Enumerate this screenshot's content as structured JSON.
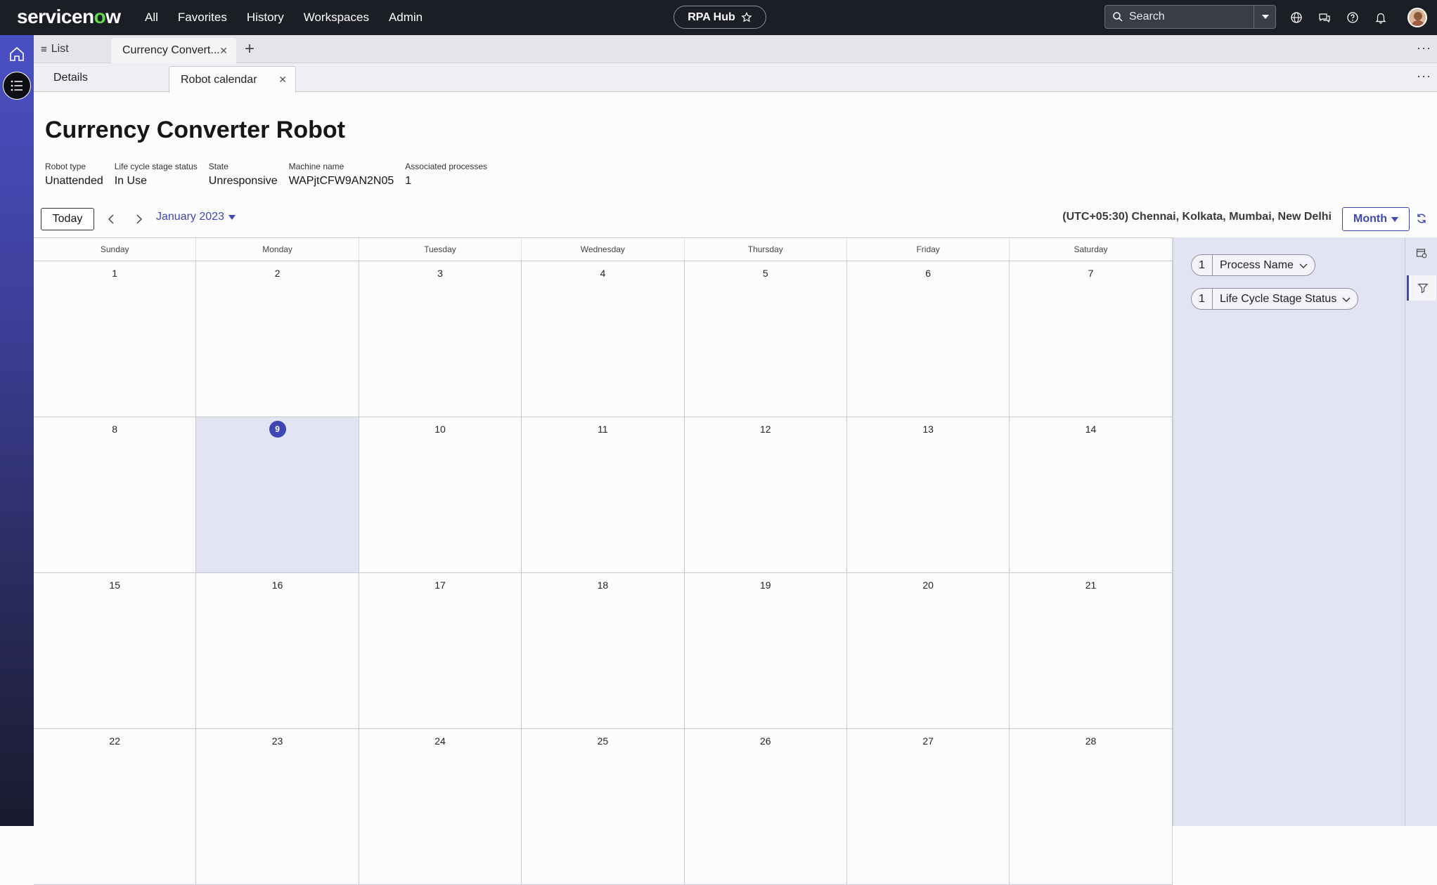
{
  "topnav": {
    "logo": "servicenow",
    "links": [
      "All",
      "Favorites",
      "History",
      "Workspaces",
      "Admin"
    ],
    "app_pill": "RPA Hub",
    "search_placeholder": "Search"
  },
  "tabstrip": {
    "list_label": "List",
    "open_tab": "Currency Convert..."
  },
  "subtabs": {
    "details": "Details",
    "robot_calendar": "Robot calendar"
  },
  "record": {
    "title": "Currency Converter Robot",
    "fields": [
      {
        "label": "Robot type",
        "value": "Unattended"
      },
      {
        "label": "Life cycle stage status",
        "value": "In Use"
      },
      {
        "label": "State",
        "value": "Unresponsive"
      },
      {
        "label": "Machine name",
        "value": "WAPjtCFW9AN2N05"
      },
      {
        "label": "Associated processes",
        "value": "1"
      }
    ]
  },
  "calendar": {
    "today_label": "Today",
    "month_label": "January 2023",
    "timezone": "(UTC+05:30) Chennai, Kolkata, Mumbai, New Delhi",
    "view_label": "Month",
    "weekdays": [
      "Sunday",
      "Monday",
      "Tuesday",
      "Wednesday",
      "Thursday",
      "Friday",
      "Saturday"
    ],
    "weeks": [
      [
        "1",
        "2",
        "3",
        "4",
        "5",
        "6",
        "7"
      ],
      [
        "8",
        "9",
        "10",
        "11",
        "12",
        "13",
        "14"
      ],
      [
        "15",
        "16",
        "17",
        "18",
        "19",
        "20",
        "21"
      ],
      [
        "22",
        "23",
        "24",
        "25",
        "26",
        "27",
        "28"
      ]
    ],
    "today_date": "9"
  },
  "filters": [
    {
      "count": "1",
      "label": "Process Name"
    },
    {
      "count": "1",
      "label": "Life Cycle Stage Status"
    }
  ],
  "colors": {
    "accent": "#3f47b5",
    "nav_bg": "#1c1e26",
    "panel_bg": "#e3e4f3"
  }
}
